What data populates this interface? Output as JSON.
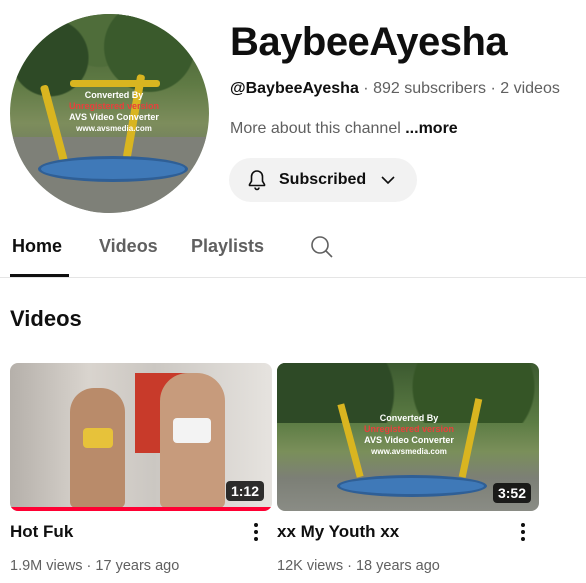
{
  "channel": {
    "name": "BaybeeAyesha",
    "handle": "@BaybeeAyesha",
    "subscribers": "892 subscribers",
    "video_count": "2 videos",
    "separator": " · ",
    "about_text": "More about this channel",
    "about_more": "...more",
    "avatar_watermark": [
      "Converted By",
      "Unregistered version",
      "AVS Video Converter",
      "www.avsmedia.com"
    ]
  },
  "subscribe_button": {
    "label": "Subscribed",
    "icon": "bell-icon",
    "chevron": "chevron-down-icon"
  },
  "tabs": [
    {
      "label": "Home",
      "active": true
    },
    {
      "label": "Videos",
      "active": false
    },
    {
      "label": "Playlists",
      "active": false
    }
  ],
  "section": {
    "title": "Videos"
  },
  "videos": [
    {
      "title": "Hot Fuk",
      "duration": "1:12",
      "views": "1.9M views",
      "age": "17 years ago",
      "watched_fraction": 1.0
    },
    {
      "title": "xx My Youth xx",
      "duration": "3:52",
      "views": "12K views",
      "age": "18 years ago",
      "watermark": [
        "Converted By",
        "Unregistered version",
        "AVS Video Converter",
        "www.avsmedia.com"
      ]
    }
  ],
  "colors": {
    "accent_red": "#ff0033",
    "text_primary": "#0f0f0f",
    "text_secondary": "#606060",
    "button_bg": "#f2f2f2"
  }
}
